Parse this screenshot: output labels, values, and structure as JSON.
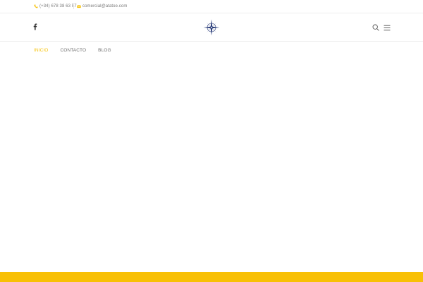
{
  "topbar": {
    "phone": "(+34) 678 38 63 57",
    "email": "comercial@atatoe.com",
    "phone_icon": "phone-icon",
    "email_icon": "envelope-icon"
  },
  "header": {
    "social_icon": "facebook-icon",
    "logo_icon": "compass-rose-logo",
    "search_icon": "search-icon",
    "menu_icon": "hamburger-menu-icon"
  },
  "nav": {
    "items": [
      {
        "label": "INICIO",
        "active": true
      },
      {
        "label": "CONTACTO",
        "active": false
      },
      {
        "label": "BLOG",
        "active": false
      }
    ]
  },
  "colors": {
    "accent": "#f8c006",
    "text_muted": "#7a7a7a",
    "logo_navy": "#2a3d7a"
  }
}
